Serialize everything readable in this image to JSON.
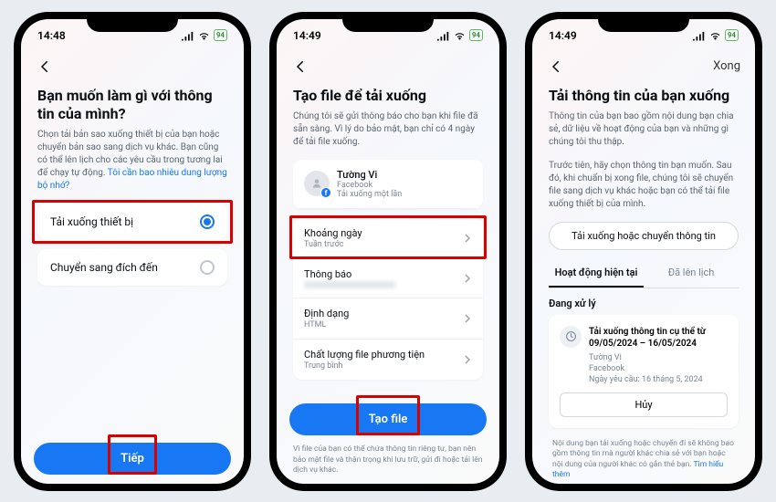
{
  "status": {
    "time1": "14:48",
    "time2": "14:49",
    "time3": "14:49",
    "battery": "94"
  },
  "screen1": {
    "title": "Bạn muốn làm gì với thông tin của mình?",
    "desc": "Chọn tải bản sao xuống thiết bị của bạn hoặc chuyển bản sao sang dịch vụ khác. Bạn cũng có thể lên lịch cho các yêu cầu trong tương lai để chạy tự động. ",
    "desc_link": "Tôi cần bao nhiêu dung lượng bộ nhớ?",
    "option_download": "Tải xuống thiết bị",
    "option_transfer": "Chuyển sang đích đến",
    "next": "Tiếp"
  },
  "screen2": {
    "title": "Tạo file để tải xuống",
    "desc": "Chúng tôi sẽ gửi thông báo cho bạn khi file đã sẵn sàng. Vì lý do bảo mật, bạn chỉ có 4 ngày để tải file xuống.",
    "profile_name": "Tường Vi",
    "profile_platform": "Facebook",
    "profile_note": "Tải xuống một lần",
    "rows": {
      "date_label": "Khoảng ngày",
      "date_value": "Tuần trước",
      "notif_label": "Thông báo",
      "notif_value": "",
      "format_label": "Định dạng",
      "format_value": "HTML",
      "quality_label": "Chất lượng file phương tiện",
      "quality_value": "Trung bình"
    },
    "create": "Tạo file",
    "footer": "Vì file của bạn có thể chứa thông tin riêng tư, bạn nên bảo mật file và thận trọng khi lưu trữ, gửi đi hoặc tải lên dịch vụ khác."
  },
  "screen3": {
    "done": "Xong",
    "title": "Tải thông tin của bạn xuống",
    "desc": "Thông tin của bạn bao gồm nội dung bạn chia sẻ, dữ liệu về hoạt động của bạn và những gì chúng tôi thu thập.",
    "desc2": "Trước tiên, hãy chọn thông tin bạn muốn. Sau đó, khi chuẩn bị xong file, chúng tôi sẽ chuyển file sang dịch vụ khác hoặc bạn có thể tải file xuống thiết bị của mình.",
    "pill": "Tải xuống hoặc chuyển thông tin",
    "tab_current": "Hoạt động hiện tại",
    "tab_scheduled": "Đã lên lịch",
    "processing_label": "Đang xử lý",
    "proc_title": "Tải xuống thông tin cụ thể từ 09/05/2024 – 16/05/2024",
    "proc_name": "Tường Vi",
    "proc_platform": "Facebook",
    "proc_date": "Ngày yêu cầu: 16 tháng 5, 2024",
    "cancel": "Hủy",
    "footer": "Nội dung bạn tải xuống hoặc chuyển đi sẽ không bao gồm thông tin mà người khác chia sẻ với bạn hoặc nội dung của người khác có gắn thẻ bạn. ",
    "footer_link": "Tìm hiểu thêm"
  }
}
